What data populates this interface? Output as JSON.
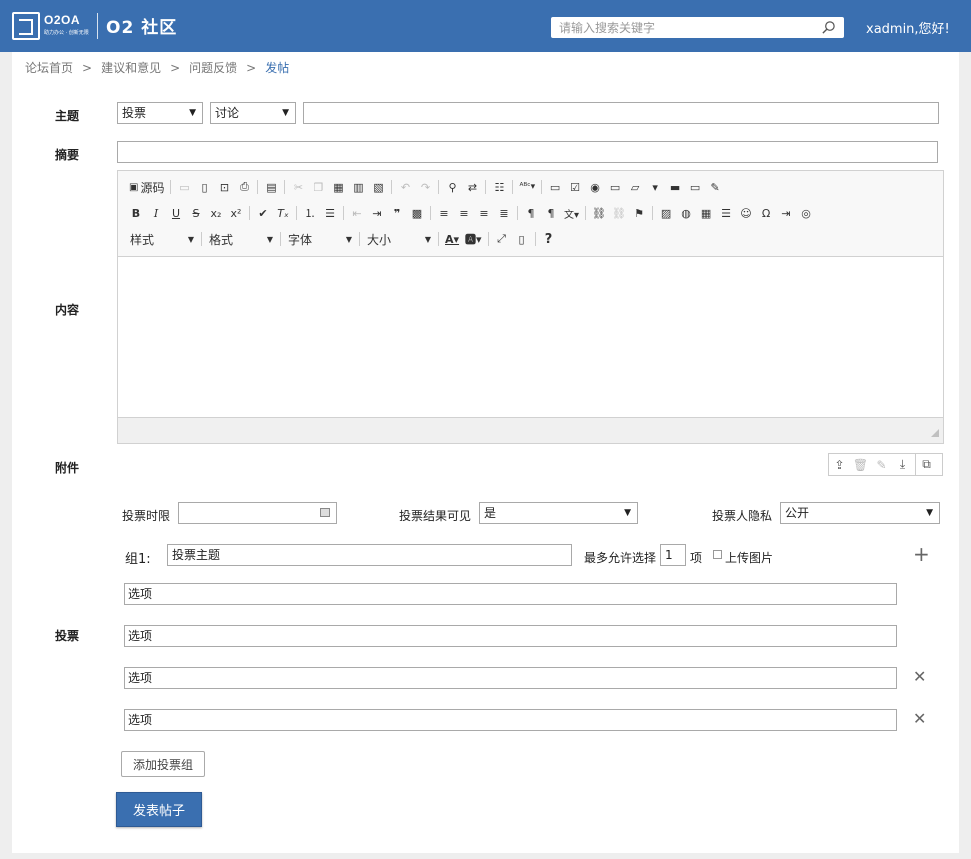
{
  "header": {
    "logo_text": "O2OA",
    "logo_sub": "助力办公 · 创新无限",
    "site_title": "O2 社区",
    "search_placeholder": "请输入搜索关键字",
    "user_greeting": "xadmin,您好!"
  },
  "breadcrumb": {
    "items": [
      "论坛首页",
      "建议和意见",
      "问题反馈"
    ],
    "current": "发帖",
    "separator": ">"
  },
  "form": {
    "subject_label": "主题",
    "subject_type_1": "投票",
    "subject_type_2": "讨论",
    "subject_value": "",
    "summary_label": "摘要",
    "summary_value": "",
    "content_label": "内容",
    "attachment_label": "附件",
    "vote_label": "投票"
  },
  "editor": {
    "source_label": "源码",
    "style_combo": "样式",
    "format_combo": "格式",
    "font_combo": "字体",
    "size_combo": "大小",
    "help": "?"
  },
  "vote": {
    "deadline_label": "投票时限",
    "deadline_value": "",
    "result_visible_label": "投票结果可见",
    "result_visible_value": "是",
    "privacy_label": "投票人隐私",
    "privacy_value": "公开",
    "group_label": "组1:",
    "group_subject": "投票主题",
    "max_select_label": "最多允许选择",
    "max_select_value": "1",
    "max_select_unit": "项",
    "upload_image_label": "上传图片",
    "options": [
      "选项",
      "选项",
      "选项",
      "选项"
    ],
    "add_group_label": "添加投票组",
    "submit_label": "发表帖子"
  },
  "colors": {
    "brand": "#3a6fb0",
    "background": "#eeeeee"
  }
}
